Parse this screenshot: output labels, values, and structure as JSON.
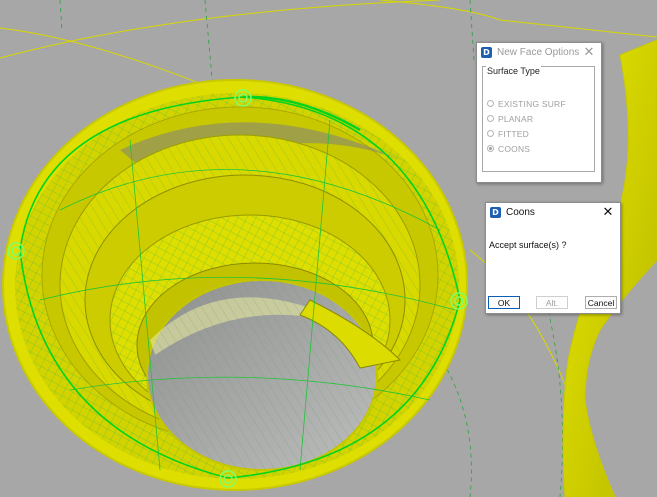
{
  "viewport": {
    "colors": {
      "background": "#a7a7a7",
      "surface": "#dcdc00",
      "edge_highlight": "#00e020",
      "grid": "#3fb54a"
    },
    "selection_markers": [
      "marker-top",
      "marker-left",
      "marker-right",
      "marker-bottom"
    ]
  },
  "new_face_dialog": {
    "title": "New Face Options",
    "close_icon": "close-icon",
    "group_label": "Surface Type",
    "options": [
      {
        "label": "EXISTING SURF",
        "selected": false
      },
      {
        "label": "PLANAR",
        "selected": false
      },
      {
        "label": "FITTED",
        "selected": false
      },
      {
        "label": "COONS",
        "selected": true
      }
    ]
  },
  "coons_dialog": {
    "title": "Coons",
    "close_icon": "close-icon",
    "message": "Accept surface(s) ?",
    "buttons": {
      "ok": "OK",
      "alt": "Alt.",
      "cancel": "Cancel"
    }
  }
}
